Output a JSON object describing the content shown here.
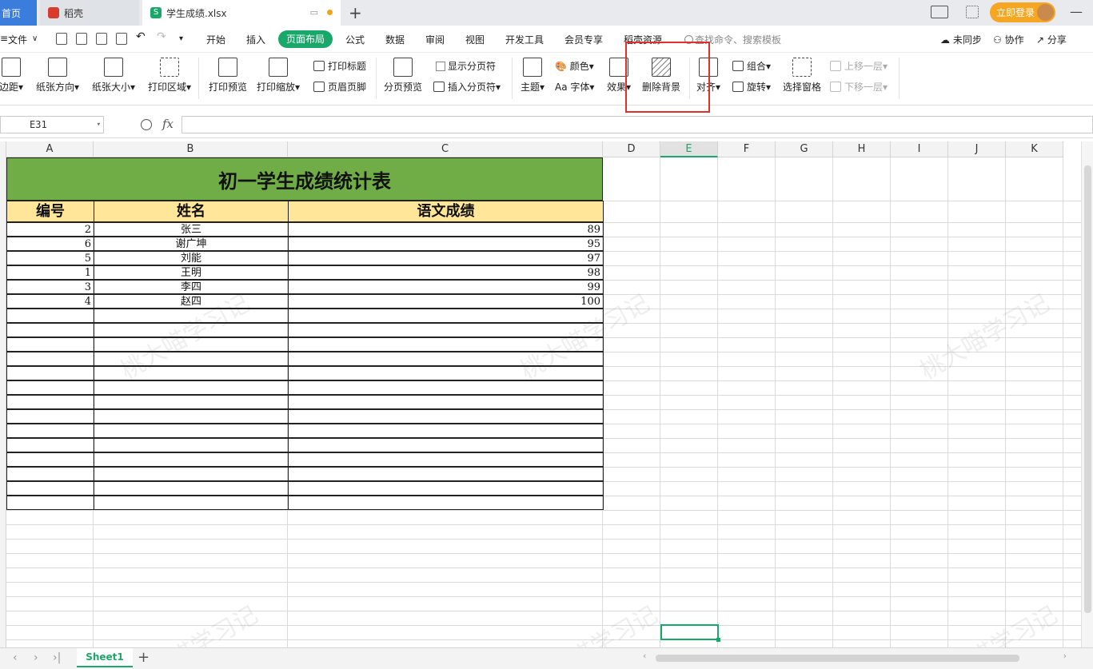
{
  "tabs": {
    "home": "首页",
    "daoke": "稻壳",
    "file": "学生成绩.xlsx"
  },
  "titlebar": {
    "login": "立即登录",
    "new_tab": "+",
    "minimize": "—"
  },
  "menu": {
    "file": "文件",
    "items": [
      "开始",
      "插入",
      "页面布局",
      "公式",
      "数据",
      "审阅",
      "视图",
      "开发工具",
      "会员专享",
      "稻壳资源"
    ],
    "active": "页面布局",
    "search": "查找命令、搜索模板",
    "sync": "未同步",
    "collab": "协作",
    "share": "分享"
  },
  "ribbon": {
    "margins": "边距",
    "orientation": "纸张方向",
    "size": "纸张大小",
    "print_area": "打印区域",
    "print_preview": "打印预览",
    "print_scale": "打印缩放",
    "print_titles": "打印标题",
    "header_footer": "页眉页脚",
    "page_break_preview": "分页预览",
    "show_page_breaks": "显示分页符",
    "insert_page_break": "插入分页符",
    "theme": "主题",
    "colors": "颜色",
    "fonts": "字体",
    "effects": "效果",
    "remove_background": "删除背景",
    "align": "对齐",
    "group": "组合",
    "rotate": "旋转",
    "selection_pane": "选择窗格",
    "bring_forward": "上移一层",
    "send_backward": "下移一层"
  },
  "formula_bar": {
    "name_box": "E31",
    "fx": "fx",
    "value": ""
  },
  "columns": [
    "A",
    "B",
    "C",
    "D",
    "E",
    "F",
    "G",
    "H",
    "I",
    "J",
    "K"
  ],
  "selected_column": "E",
  "table": {
    "title": "初一学生成绩统计表",
    "headers": [
      "编号",
      "姓名",
      "语文成绩"
    ],
    "rows": [
      {
        "id": "2",
        "name": "张三",
        "score": "89"
      },
      {
        "id": "6",
        "name": "谢广坤",
        "score": "95"
      },
      {
        "id": "5",
        "name": "刘能",
        "score": "97"
      },
      {
        "id": "1",
        "name": "王明",
        "score": "98"
      },
      {
        "id": "3",
        "name": "李四",
        "score": "99"
      },
      {
        "id": "4",
        "name": "赵四",
        "score": "100"
      }
    ]
  },
  "watermark": "桃大喵学习记",
  "sheets": {
    "active": "Sheet1",
    "add": "+"
  },
  "colors": {
    "accent": "#1aa86a",
    "title_fill": "#70ad47",
    "header_fill": "#ffe699",
    "highlight": "#e0302a"
  }
}
